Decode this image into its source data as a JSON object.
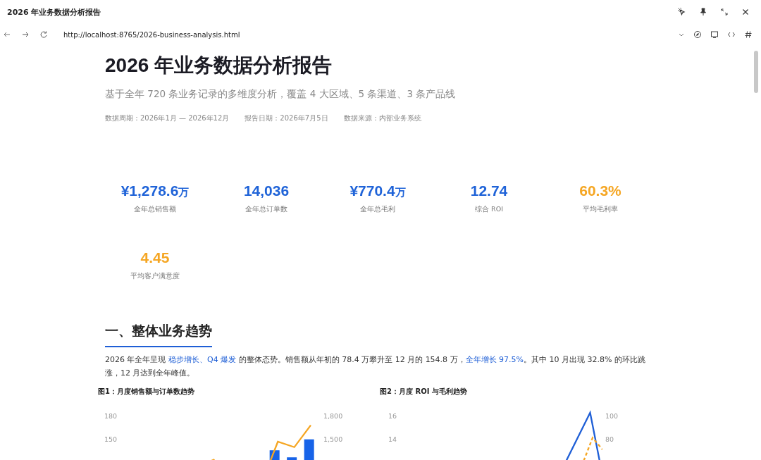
{
  "window": {
    "title": "2026 年业务数据分析报告"
  },
  "address_bar": {
    "url": "http://localhost:8765/2026-business-analysis.html"
  },
  "report": {
    "title": "2026 年业务数据分析报告",
    "subtitle": "基于全年 720 条业务记录的多维度分析，覆盖 4 大区域、5 条渠道、3 条产品线",
    "meta": [
      {
        "label": "数据周期：",
        "value": "2026年1月 — 2026年12月"
      },
      {
        "label": "报告日期：",
        "value": "2026年7月5日"
      },
      {
        "label": "数据来源：",
        "value": "内部业务系统"
      }
    ]
  },
  "kpis": [
    {
      "value": "¥1,278.6",
      "unit": "万",
      "label": "全年总销售额",
      "color": "#1f63d8"
    },
    {
      "value": "14,036",
      "label": "全年总订单数",
      "color": "#1f63d8"
    },
    {
      "value": "¥770.4",
      "unit": "万",
      "label": "全年总毛利",
      "color": "#1f63d8"
    },
    {
      "value": "12.74",
      "label": "综合 ROI",
      "color": "#1f63d8"
    },
    {
      "value": "60.3%",
      "label": "平均毛利率",
      "color": "#f5a623"
    },
    {
      "value": "4.45",
      "label": "平均客户满意度",
      "color": "#f5a623"
    }
  ],
  "section": {
    "heading": "一、整体业务趋势",
    "paragraph": "2026 年全年呈现 **稳步增长、Q4 爆发** 的整体态势。销售额从年初的 78.4 万攀升至 12 月的 154.8 万，**全年增长 97.5%**。其中 10 月出现 32.8% 的环比跳涨，12 月达到全年峰值。"
  },
  "figures": [
    {
      "title": "图1：月度销售额与订单数趋势",
      "left_ticks": [
        "180",
        "150"
      ],
      "right_ticks": [
        "1,800",
        "1,500"
      ]
    },
    {
      "title": "图2：月度 ROI 与毛利趋势",
      "left_ticks": [
        "16",
        "14"
      ],
      "right_ticks": [
        "100",
        "80"
      ]
    }
  ]
}
